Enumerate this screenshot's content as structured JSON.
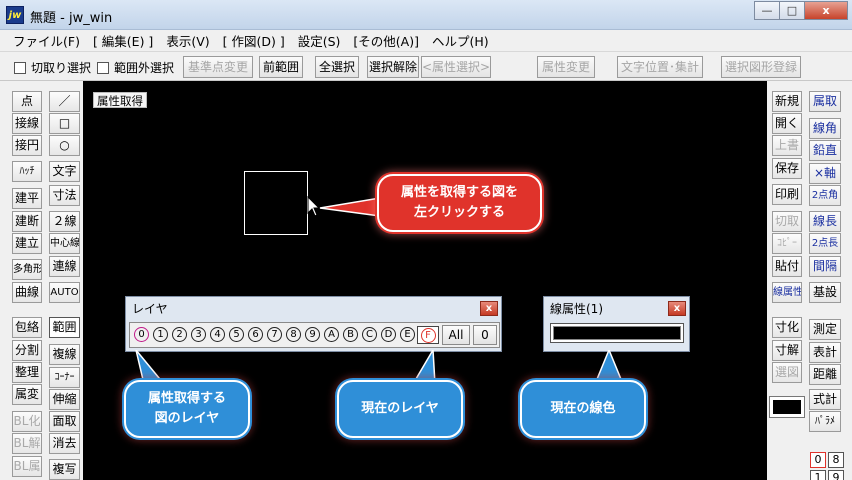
{
  "window": {
    "title": "無題 - jw_win",
    "app_icon_text": "jw",
    "minimize": "—",
    "maximize": "□",
    "close": "x"
  },
  "menu": [
    "ファイル(F)",
    "[ 編集(E) ]",
    "表示(V)",
    "[ 作図(D) ]",
    "設定(S)",
    "[その他(A)]",
    "ヘルプ(H)"
  ],
  "toolbar": {
    "chk_select": "切取り選択",
    "chk_outside": "範囲外選択",
    "btn_base": "基準点変更",
    "btn_prev": "前範囲",
    "btn_all": "全選択",
    "btn_deselect": "選択解除",
    "btn_attr_select": "<属性選択>",
    "btn_attr_change": "属性変更",
    "btn_text_pos": "文字位置･集計",
    "btn_register": "選択図形登録"
  },
  "left_col1": [
    "点",
    "接線",
    "接円",
    "ﾊｯﾁ",
    "建平",
    "建断",
    "建立",
    "多角形",
    "曲線",
    "包絡",
    "分割",
    "整理",
    "属変",
    "BL化",
    "BL解",
    "BL属"
  ],
  "left_col2": [
    "／",
    "□",
    "○",
    "文字",
    "寸法",
    "２線",
    "中心線",
    "連線",
    "AUTO",
    "範囲",
    "複線",
    "ｺｰﾅｰ",
    "伸縮",
    "面取",
    "消去",
    "複写"
  ],
  "right_col1": [
    "新規",
    "開く",
    "上書",
    "保存",
    "印刷",
    "切取",
    "ｺﾋﾟｰ",
    "貼付",
    "線属性",
    "寸化",
    "寸解",
    "選図"
  ],
  "right_col2": [
    "属取",
    "線角",
    "鉛直",
    "×軸",
    "2点角",
    "線長",
    "2点長",
    "間隔",
    "基設",
    "測定",
    "表計",
    "距離",
    "式計",
    "ﾊﾟﾗﾒ"
  ],
  "right_numbers": [
    "0",
    "8",
    "1",
    "9"
  ],
  "canvas": {
    "mode_label": "属性取得"
  },
  "layer_panel": {
    "title": "レイヤ",
    "close": "x",
    "layers": [
      "0",
      "1",
      "2",
      "3",
      "4",
      "5",
      "6",
      "7",
      "8",
      "9",
      "A",
      "B",
      "C",
      "D",
      "E",
      "F"
    ],
    "current": "F",
    "btn_all": "All",
    "btn_zero": "0"
  },
  "line_panel": {
    "title": "線属性(1)",
    "close": "x"
  },
  "callouts": {
    "click_target": "属性を取得する図を\n左クリックする",
    "layer_of_figure": "属性取得する\n図のレイヤ",
    "current_layer": "現在のレイヤ",
    "current_color": "現在の線色"
  },
  "colors": {
    "callout_red": "#e0332b",
    "callout_blue": "#2f8fd8",
    "canvas_bg": "#000000"
  }
}
